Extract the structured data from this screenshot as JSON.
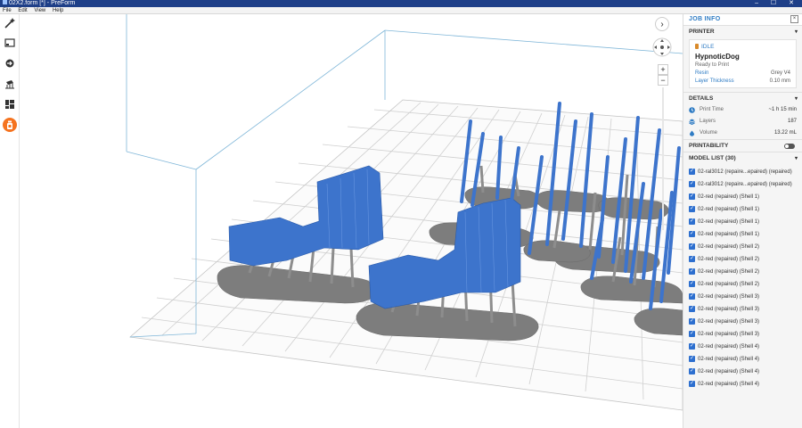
{
  "window": {
    "title": "02X2.form [*] - PreForm",
    "controls": "– ☐ ✕"
  },
  "menu": {
    "file": "File",
    "edit": "Edit",
    "view": "View",
    "help": "Help"
  },
  "toolbar": {
    "tools": [
      "magic-wand-icon",
      "layout-icon",
      "orientation-icon",
      "supports-icon",
      "layout-grid-icon",
      "print-icon"
    ]
  },
  "viewport": {
    "nav_chevron": "›",
    "zoom_plus": "+",
    "zoom_minus": "−"
  },
  "panel": {
    "title": "JOB INFO",
    "close": "×",
    "printer": {
      "header": "PRINTER",
      "status": "IDLE",
      "name": "HypnoticDog",
      "ready": "Ready to Print",
      "resin_label": "Resin",
      "resin_value": "Grey V4",
      "layer_label": "Layer Thickness",
      "layer_value": "0.10 mm"
    },
    "details": {
      "header": "DETAILS",
      "print_time_label": "Print Time",
      "print_time_value": "~1 h 15 min",
      "layers_label": "Layers",
      "layers_value": "187",
      "volume_label": "Volume",
      "volume_value": "13.22 mL"
    },
    "printability": {
      "header": "PRINTABILITY"
    },
    "model_list": {
      "header": "MODEL LIST (30)",
      "items": [
        "02-ral3012 (repaire...epaired) (repaired)",
        "02-ral3012 (repaire...epaired) (repaired)",
        "02-red (repaired) (Shell 1)",
        "02-red (repaired) (Shell 1)",
        "02-red (repaired) (Shell 1)",
        "02-red (repaired) (Shell 1)",
        "02-red (repaired) (Shell 2)",
        "02-red (repaired) (Shell 2)",
        "02-red (repaired) (Shell 2)",
        "02-red (repaired) (Shell 2)",
        "02-red (repaired) (Shell 3)",
        "02-red (repaired) (Shell 3)",
        "02-red (repaired) (Shell 3)",
        "02-red (repaired) (Shell 3)",
        "02-red (repaired) (Shell 4)",
        "02-red (repaired) (Shell 4)",
        "02-red (repaired) (Shell 4)",
        "02-red (repaired) (Shell 4)"
      ]
    }
  },
  "colors": {
    "accent": "#2f7cc4",
    "active_tool": "#f5731f",
    "model_blue": "#3d74cc",
    "support_grey": "#8a8a8a"
  }
}
